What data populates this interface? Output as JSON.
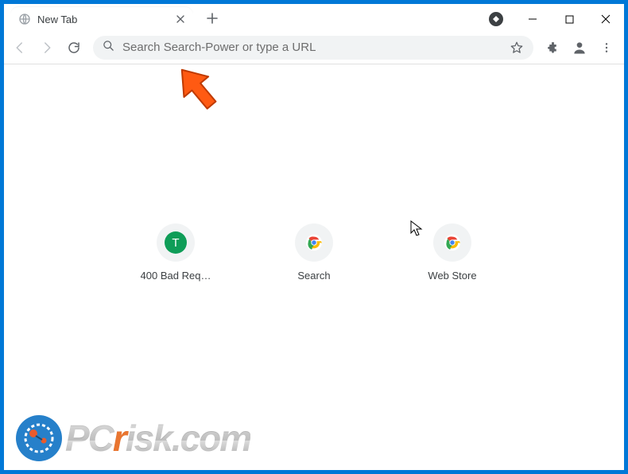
{
  "window": {
    "tab_title": "New Tab"
  },
  "omnibox": {
    "placeholder": "Search Search-Power or type a URL",
    "value": ""
  },
  "shortcuts": [
    {
      "label": "400 Bad Req…",
      "icon": "letter",
      "letter": "T",
      "bg": "#0f9d58"
    },
    {
      "label": "Search",
      "icon": "chrome"
    },
    {
      "label": "Web Store",
      "icon": "chrome"
    }
  ],
  "watermark": {
    "text_prefix": "PC",
    "text_accent": "r",
    "text_suffix": "isk.com"
  }
}
